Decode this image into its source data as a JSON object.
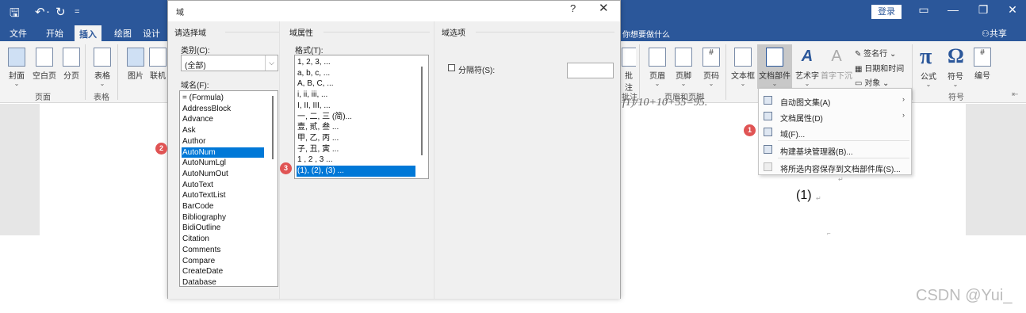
{
  "word": {
    "quick_access": [
      "🖫",
      "↶",
      "·",
      "↻",
      "="
    ],
    "login": "登录",
    "tabs": [
      "文件",
      "开始",
      "插入",
      "绘图",
      "设计"
    ],
    "tell_me": "你想要做什么",
    "share": "共享",
    "left_buttons": [
      "封面",
      "空白页",
      "分页",
      "表格",
      "图片",
      "联机"
    ],
    "left_groups": [
      "页面",
      "表格"
    ],
    "right_buttons": [
      "批注",
      "页眉",
      "页脚",
      "页码",
      "文本框",
      "文档部件",
      "艺术字",
      "首字下沉",
      "公式",
      "符号",
      "编号"
    ],
    "right_small": [
      "签名行",
      "日期和时间",
      "对象"
    ],
    "right_groups": [
      "批注",
      "页眉和页脚",
      "符号"
    ],
    "doc_fragment": "f1)/10+10+55=95.",
    "doc_number": "(1)"
  },
  "context_menu": {
    "items": [
      {
        "label": "自动图文集(A)",
        "arrow": "›",
        "disabled": false
      },
      {
        "label": "文档属性(D)",
        "arrow": "›",
        "disabled": false
      },
      {
        "label": "域(F)...",
        "arrow": "",
        "disabled": false
      },
      {
        "label": "构建基块管理器(B)...",
        "arrow": "",
        "disabled": false
      },
      {
        "label": "将所选内容保存到文档部件库(S)...",
        "arrow": "",
        "disabled": true
      }
    ]
  },
  "dialog": {
    "title": "域",
    "help": "?",
    "close": "✕",
    "choose_field": "请选择域",
    "category_label": "类别(C):",
    "category_value": "(全部)",
    "field_names_label": "域名(F):",
    "field_names": [
      "= (Formula)",
      "AddressBlock",
      "Advance",
      "Ask",
      "Author",
      "AutoNum",
      "AutoNumLgl",
      "AutoNumOut",
      "AutoText",
      "AutoTextList",
      "BarCode",
      "Bibliography",
      "BidiOutline",
      "Citation",
      "Comments",
      "Compare",
      "CreateDate",
      "Database"
    ],
    "field_props": "域属性",
    "format_label": "格式(T):",
    "formats": [
      "1, 2, 3, ...",
      "a, b, c, ...",
      "A, B, C, ...",
      "i, ii, iii, ...",
      "I, II, III, ...",
      "一, 二, 三 (简)...",
      "壹, 贰, 叁 ...",
      "甲, 乙, 丙 ...",
      "子, 丑, 寅 ...",
      "1 , 2 , 3 ...",
      "(1), (2), (3) ..."
    ],
    "field_options": "域选项",
    "separator_label": "分隔符(S):"
  },
  "badges": [
    "1",
    "2",
    "3"
  ],
  "watermark": "CSDN @Yui_",
  "colors": {
    "word_blue": "#2b579a",
    "selection": "#0078d7",
    "badge": "#e05454"
  }
}
